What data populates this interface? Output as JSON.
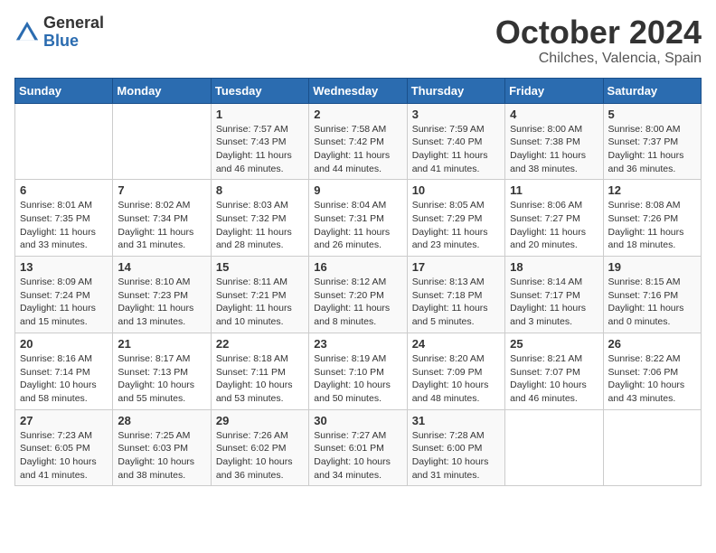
{
  "header": {
    "logo_general": "General",
    "logo_blue": "Blue",
    "month_title": "October 2024",
    "subtitle": "Chilches, Valencia, Spain"
  },
  "weekdays": [
    "Sunday",
    "Monday",
    "Tuesday",
    "Wednesday",
    "Thursday",
    "Friday",
    "Saturday"
  ],
  "weeks": [
    [
      {
        "day": "",
        "info": ""
      },
      {
        "day": "",
        "info": ""
      },
      {
        "day": "1",
        "info": "Sunrise: 7:57 AM\nSunset: 7:43 PM\nDaylight: 11 hours and 46 minutes."
      },
      {
        "day": "2",
        "info": "Sunrise: 7:58 AM\nSunset: 7:42 PM\nDaylight: 11 hours and 44 minutes."
      },
      {
        "day": "3",
        "info": "Sunrise: 7:59 AM\nSunset: 7:40 PM\nDaylight: 11 hours and 41 minutes."
      },
      {
        "day": "4",
        "info": "Sunrise: 8:00 AM\nSunset: 7:38 PM\nDaylight: 11 hours and 38 minutes."
      },
      {
        "day": "5",
        "info": "Sunrise: 8:00 AM\nSunset: 7:37 PM\nDaylight: 11 hours and 36 minutes."
      }
    ],
    [
      {
        "day": "6",
        "info": "Sunrise: 8:01 AM\nSunset: 7:35 PM\nDaylight: 11 hours and 33 minutes."
      },
      {
        "day": "7",
        "info": "Sunrise: 8:02 AM\nSunset: 7:34 PM\nDaylight: 11 hours and 31 minutes."
      },
      {
        "day": "8",
        "info": "Sunrise: 8:03 AM\nSunset: 7:32 PM\nDaylight: 11 hours and 28 minutes."
      },
      {
        "day": "9",
        "info": "Sunrise: 8:04 AM\nSunset: 7:31 PM\nDaylight: 11 hours and 26 minutes."
      },
      {
        "day": "10",
        "info": "Sunrise: 8:05 AM\nSunset: 7:29 PM\nDaylight: 11 hours and 23 minutes."
      },
      {
        "day": "11",
        "info": "Sunrise: 8:06 AM\nSunset: 7:27 PM\nDaylight: 11 hours and 20 minutes."
      },
      {
        "day": "12",
        "info": "Sunrise: 8:08 AM\nSunset: 7:26 PM\nDaylight: 11 hours and 18 minutes."
      }
    ],
    [
      {
        "day": "13",
        "info": "Sunrise: 8:09 AM\nSunset: 7:24 PM\nDaylight: 11 hours and 15 minutes."
      },
      {
        "day": "14",
        "info": "Sunrise: 8:10 AM\nSunset: 7:23 PM\nDaylight: 11 hours and 13 minutes."
      },
      {
        "day": "15",
        "info": "Sunrise: 8:11 AM\nSunset: 7:21 PM\nDaylight: 11 hours and 10 minutes."
      },
      {
        "day": "16",
        "info": "Sunrise: 8:12 AM\nSunset: 7:20 PM\nDaylight: 11 hours and 8 minutes."
      },
      {
        "day": "17",
        "info": "Sunrise: 8:13 AM\nSunset: 7:18 PM\nDaylight: 11 hours and 5 minutes."
      },
      {
        "day": "18",
        "info": "Sunrise: 8:14 AM\nSunset: 7:17 PM\nDaylight: 11 hours and 3 minutes."
      },
      {
        "day": "19",
        "info": "Sunrise: 8:15 AM\nSunset: 7:16 PM\nDaylight: 11 hours and 0 minutes."
      }
    ],
    [
      {
        "day": "20",
        "info": "Sunrise: 8:16 AM\nSunset: 7:14 PM\nDaylight: 10 hours and 58 minutes."
      },
      {
        "day": "21",
        "info": "Sunrise: 8:17 AM\nSunset: 7:13 PM\nDaylight: 10 hours and 55 minutes."
      },
      {
        "day": "22",
        "info": "Sunrise: 8:18 AM\nSunset: 7:11 PM\nDaylight: 10 hours and 53 minutes."
      },
      {
        "day": "23",
        "info": "Sunrise: 8:19 AM\nSunset: 7:10 PM\nDaylight: 10 hours and 50 minutes."
      },
      {
        "day": "24",
        "info": "Sunrise: 8:20 AM\nSunset: 7:09 PM\nDaylight: 10 hours and 48 minutes."
      },
      {
        "day": "25",
        "info": "Sunrise: 8:21 AM\nSunset: 7:07 PM\nDaylight: 10 hours and 46 minutes."
      },
      {
        "day": "26",
        "info": "Sunrise: 8:22 AM\nSunset: 7:06 PM\nDaylight: 10 hours and 43 minutes."
      }
    ],
    [
      {
        "day": "27",
        "info": "Sunrise: 7:23 AM\nSunset: 6:05 PM\nDaylight: 10 hours and 41 minutes."
      },
      {
        "day": "28",
        "info": "Sunrise: 7:25 AM\nSunset: 6:03 PM\nDaylight: 10 hours and 38 minutes."
      },
      {
        "day": "29",
        "info": "Sunrise: 7:26 AM\nSunset: 6:02 PM\nDaylight: 10 hours and 36 minutes."
      },
      {
        "day": "30",
        "info": "Sunrise: 7:27 AM\nSunset: 6:01 PM\nDaylight: 10 hours and 34 minutes."
      },
      {
        "day": "31",
        "info": "Sunrise: 7:28 AM\nSunset: 6:00 PM\nDaylight: 10 hours and 31 minutes."
      },
      {
        "day": "",
        "info": ""
      },
      {
        "day": "",
        "info": ""
      }
    ]
  ]
}
